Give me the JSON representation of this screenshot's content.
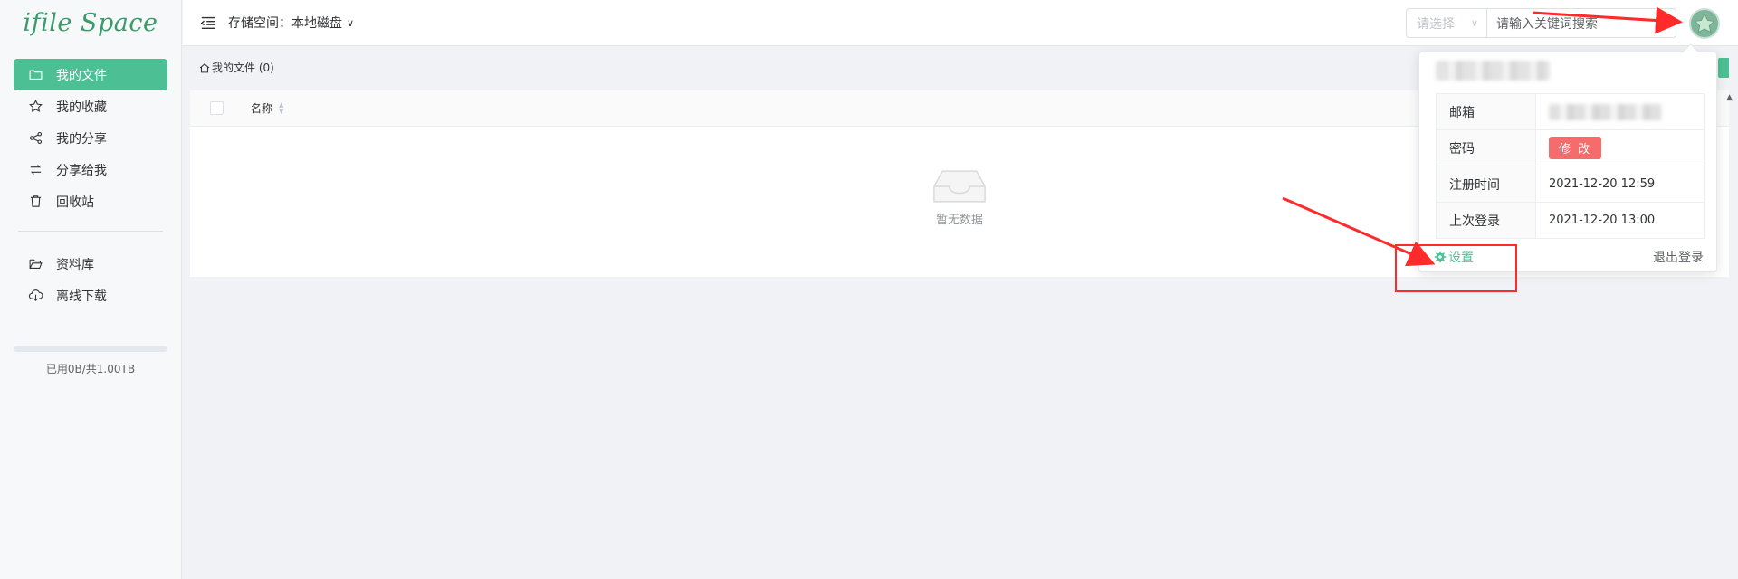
{
  "app": {
    "logo_text": "ifile Space"
  },
  "sidebar": {
    "items": [
      {
        "label": "我的文件",
        "icon": "folder-icon",
        "active": true
      },
      {
        "label": "我的收藏",
        "icon": "star-icon",
        "active": false
      },
      {
        "label": "我的分享",
        "icon": "share-icon",
        "active": false
      },
      {
        "label": "分享给我",
        "icon": "shared-with-me-icon",
        "active": false
      },
      {
        "label": "回收站",
        "icon": "trash-icon",
        "active": false
      }
    ],
    "items2": [
      {
        "label": "资料库",
        "icon": "folder-open-icon"
      },
      {
        "label": "离线下载",
        "icon": "cloud-download-icon"
      }
    ],
    "usage": {
      "text": "已用0B/共1.00TB",
      "fraction": 0
    }
  },
  "header": {
    "storage_label": "存储空间：本地磁盘",
    "select_placeholder": "请选择",
    "search_placeholder": "请输入关键词搜索"
  },
  "main": {
    "breadcrumb": "我的文件 (0)",
    "column_name": "名称",
    "empty_text": "暂无数据"
  },
  "popover": {
    "rows": [
      {
        "key": "邮箱",
        "value": ""
      },
      {
        "key": "密码",
        "value": "修 改"
      },
      {
        "key": "注册时间",
        "value": "2021-12-20 12:59"
      },
      {
        "key": "上次登录",
        "value": "2021-12-20 13:00"
      }
    ],
    "settings_label": "设置",
    "logout_label": "退出登录"
  },
  "colors": {
    "accent": "#4dbf95",
    "danger": "#f56c6c",
    "annotation": "#ff2a2a"
  }
}
